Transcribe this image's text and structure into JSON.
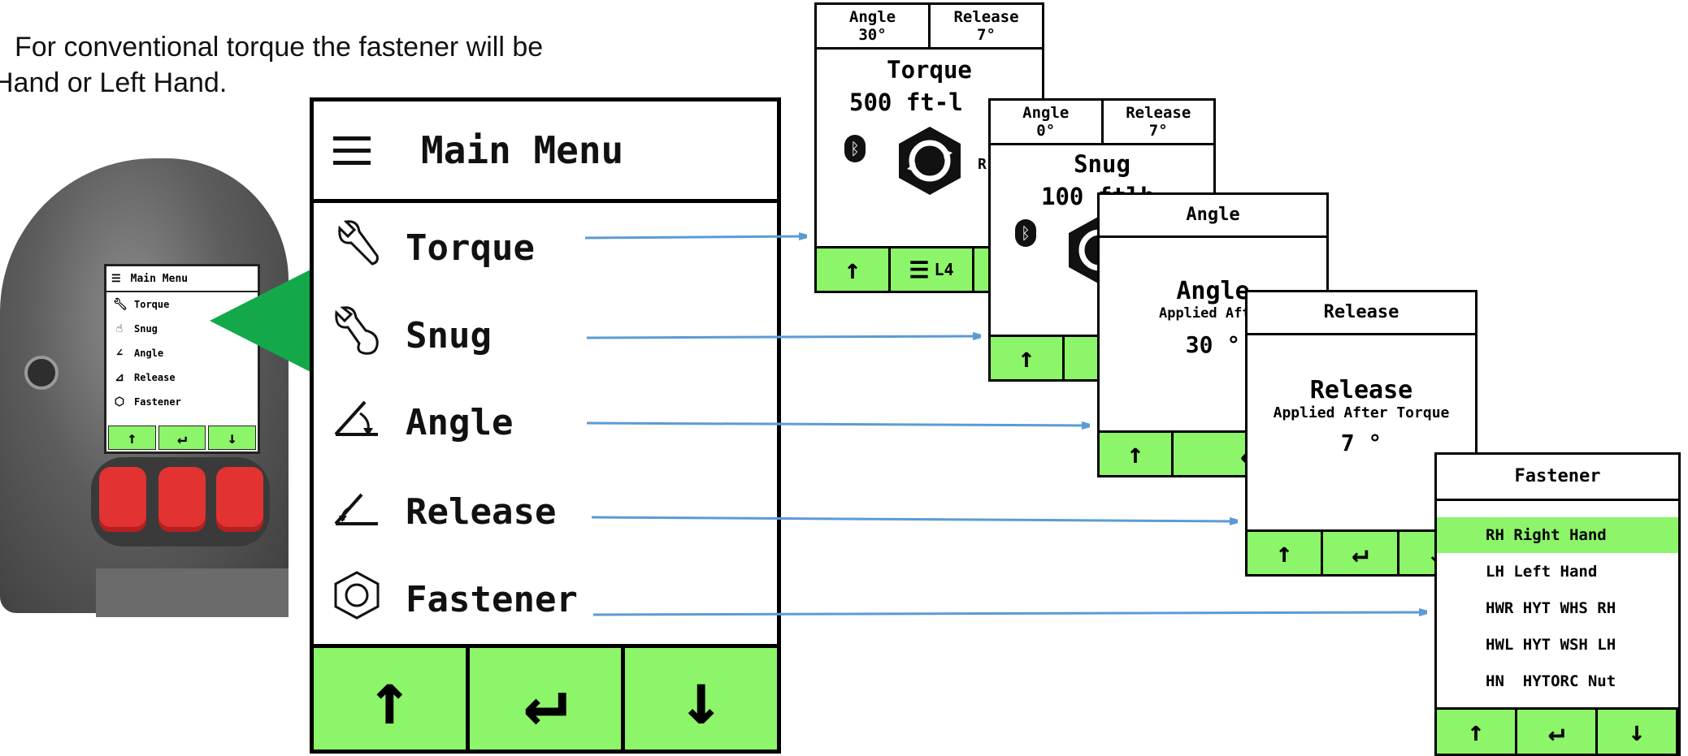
{
  "intro": {
    "line1": "For conventional torque the fastener will be",
    "line2": "Hand or Left Hand."
  },
  "device_screen": {
    "title": "Main Menu",
    "items": [
      {
        "label": "Torque",
        "icon": "wrench-icon"
      },
      {
        "label": "Snug",
        "icon": "snug-icon"
      },
      {
        "label": "Angle",
        "icon": "angle-icon"
      },
      {
        "label": "Release",
        "icon": "release-icon"
      },
      {
        "label": "Fastener",
        "icon": "hex-nut-icon"
      }
    ],
    "nav": [
      "↑",
      "↵",
      "↓"
    ]
  },
  "main_menu": {
    "title": "Main Menu",
    "items": [
      {
        "label": "Torque",
        "icon": "wrench-icon"
      },
      {
        "label": "Snug",
        "icon": "snug-icon"
      },
      {
        "label": "Angle",
        "icon": "angle-icon"
      },
      {
        "label": "Release",
        "icon": "release-icon"
      },
      {
        "label": "Fastener",
        "icon": "hex-nut-icon"
      }
    ],
    "nav": [
      "↑",
      "↵",
      "↓"
    ]
  },
  "torque_screen": {
    "header": [
      {
        "label": "Angle",
        "value": "30°"
      },
      {
        "label": "Release",
        "value": "7°"
      }
    ],
    "title": "Torque",
    "value": "500 ft-l",
    "side_label": "R",
    "nav": [
      "↑",
      "L4"
    ]
  },
  "snug_screen": {
    "header": [
      {
        "label": "Angle",
        "value": "0°"
      },
      {
        "label": "Release",
        "value": "7°"
      }
    ],
    "title": "Snug",
    "value": "100 ftlb",
    "nav": [
      "↑"
    ]
  },
  "angle_screen": {
    "header": "Angle",
    "title": "Angle",
    "subtitle": "Applied After",
    "value": "30 °",
    "nav": [
      "↑",
      "↵"
    ]
  },
  "release_screen": {
    "header": "Release",
    "title": "Release",
    "subtitle": "Applied After Torque",
    "value": "7 °",
    "nav": [
      "↑",
      "↵",
      "↓"
    ]
  },
  "fastener_screen": {
    "header": "Fastener",
    "items": [
      {
        "label": "RH Right Hand",
        "selected": true
      },
      {
        "label": "LH Left Hand",
        "selected": false
      },
      {
        "label": "HWR HYT WHS RH",
        "selected": false
      },
      {
        "label": "HWL HYT WSH LH",
        "selected": false
      },
      {
        "label": "HN  HYTORC Nut",
        "selected": false
      }
    ],
    "nav": [
      "↑",
      "↵",
      "↓"
    ]
  },
  "colors": {
    "nav_green": "#8cf56a",
    "selected_green": "#8cf56a",
    "arrow_blue": "#5b9bd5",
    "pointer_green": "#13a84a",
    "button_red": "#e23232"
  }
}
